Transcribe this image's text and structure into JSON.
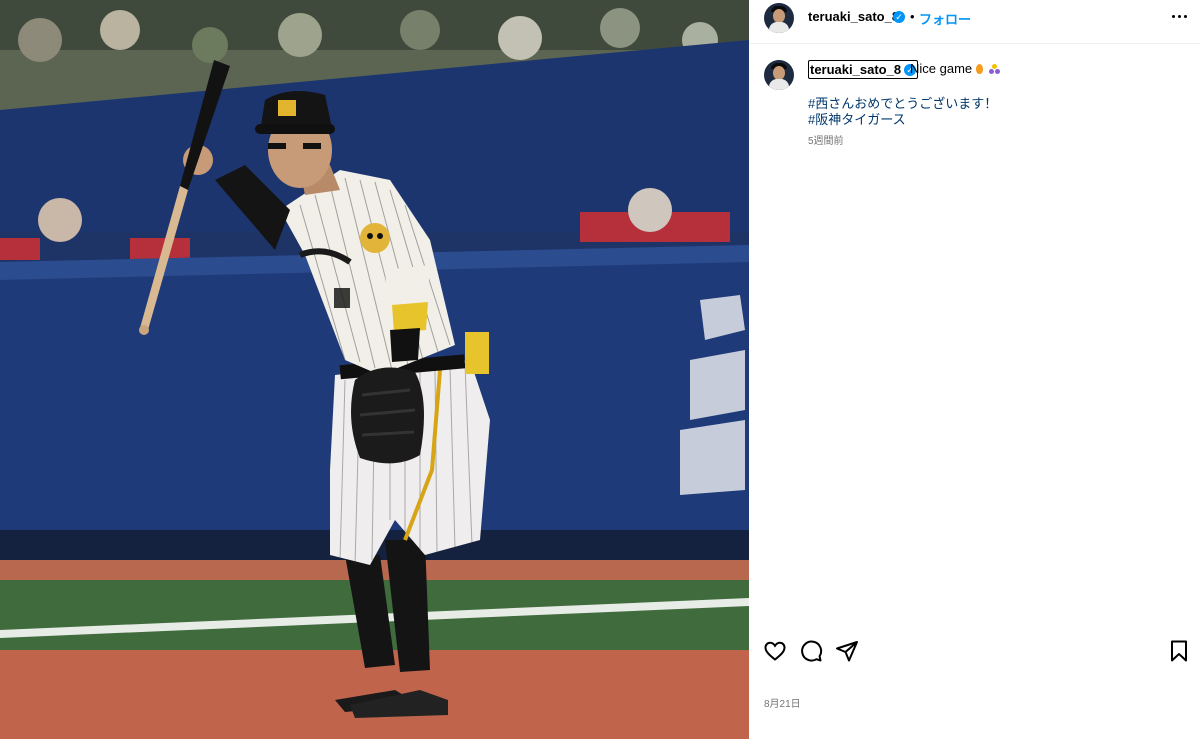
{
  "post": {
    "username": "teruaki_sato_8",
    "verified": true,
    "separator": "•",
    "follow_label": "フォロー",
    "more_icon": "more-options-icon"
  },
  "caption": {
    "username": "teruaki_sato_8",
    "text": "Nice game",
    "emojis": [
      "fire",
      "trio"
    ],
    "hashtags": [
      "#西さんおめでとうございます！",
      "#阪神タイガース"
    ],
    "time_ago": "5週間前"
  },
  "actions": {
    "icons": [
      "heart-icon",
      "comment-icon",
      "share-icon",
      "bookmark-icon"
    ]
  },
  "footer": {
    "date": "8月21日"
  },
  "colors": {
    "accent": "#0095f6",
    "hashtag": "#00376b",
    "muted": "#737373"
  }
}
